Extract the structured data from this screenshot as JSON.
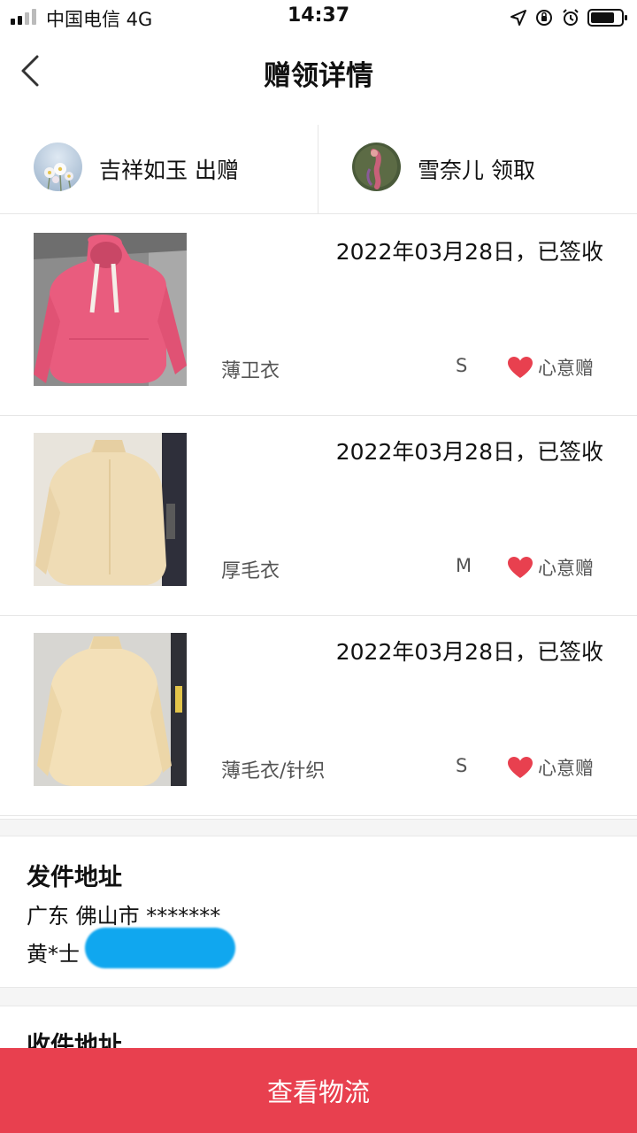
{
  "status_bar": {
    "carrier": "中国电信  4G",
    "time": "14:37"
  },
  "nav": {
    "title": "赠领详情"
  },
  "giver": {
    "text": "吉祥如玉 出赠"
  },
  "receiver": {
    "text": "雪奈儿 领取"
  },
  "items": [
    {
      "status": "2022年03月28日，已签收",
      "name": "薄卫衣",
      "size": "S",
      "tag": "心意赠"
    },
    {
      "status": "2022年03月28日，已签收",
      "name": "厚毛衣",
      "size": "M",
      "tag": "心意赠"
    },
    {
      "status": "2022年03月28日，已签收",
      "name": "薄毛衣/针织",
      "size": "S",
      "tag": "心意赠"
    }
  ],
  "send_address": {
    "heading": "发件地址",
    "region": "广东 佛山市 *******",
    "name": "黄*士"
  },
  "receive_address": {
    "heading": "收件地址"
  },
  "bottom_button": {
    "label": "查看物流"
  },
  "colors": {
    "accent": "#e8404f",
    "heart": "#e8404f"
  }
}
